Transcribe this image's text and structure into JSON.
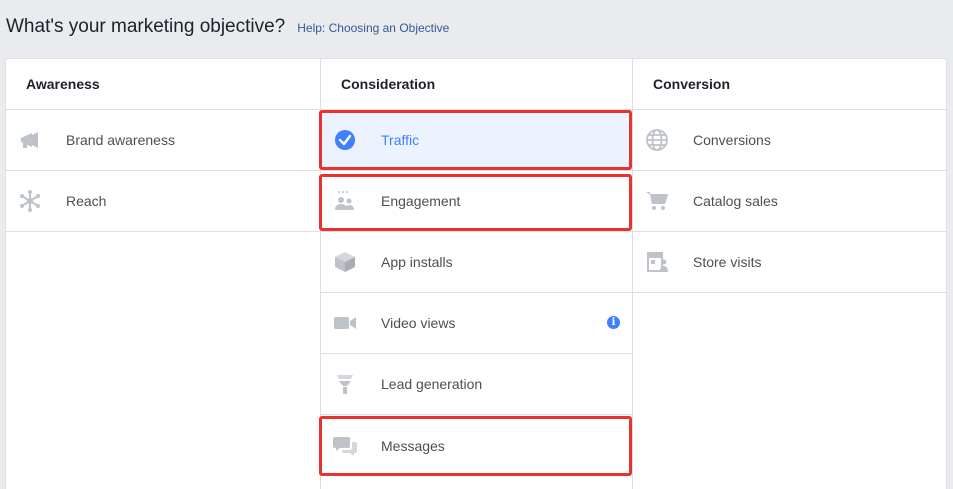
{
  "header": {
    "title": "What's your marketing objective?",
    "help_link": "Help: Choosing an Objective"
  },
  "columns": [
    {
      "title": "Awareness",
      "items": [
        {
          "label": "Brand awareness",
          "icon": "megaphone-icon"
        },
        {
          "label": "Reach",
          "icon": "reach-icon"
        }
      ]
    },
    {
      "title": "Consideration",
      "items": [
        {
          "label": "Traffic",
          "icon": "checkmark-circle-icon",
          "selected": true
        },
        {
          "label": "Engagement",
          "icon": "people-icon"
        },
        {
          "label": "App installs",
          "icon": "box-icon"
        },
        {
          "label": "Video views",
          "icon": "video-camera-icon",
          "info": "i"
        },
        {
          "label": "Lead generation",
          "icon": "funnel-icon"
        },
        {
          "label": "Messages",
          "icon": "chat-bubbles-icon"
        }
      ]
    },
    {
      "title": "Conversion",
      "items": [
        {
          "label": "Conversions",
          "icon": "globe-icon"
        },
        {
          "label": "Catalog sales",
          "icon": "shopping-cart-icon"
        },
        {
          "label": "Store visits",
          "icon": "store-icon"
        }
      ]
    }
  ],
  "colors": {
    "selected_bg": "#ecf3ff",
    "selected_text": "#4080ff",
    "highlight_border": "#e8322d",
    "icon_gray": "#bec3c9",
    "link": "#365899"
  }
}
